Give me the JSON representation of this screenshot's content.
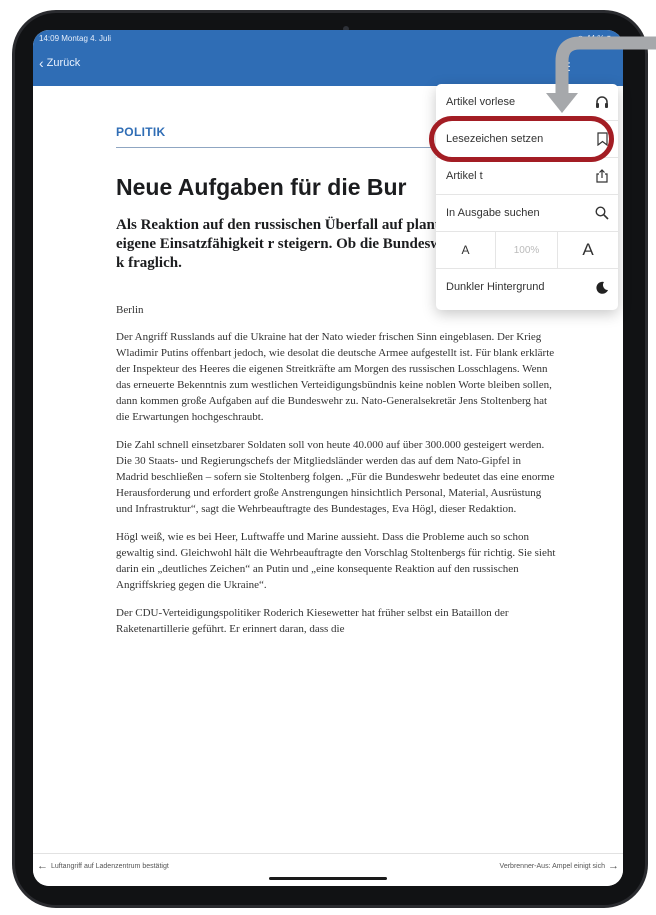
{
  "status": {
    "time_date": "14:09  Montag 4. Juli",
    "right": "◉ 44 % ▮"
  },
  "nav": {
    "back_label": "Zurück"
  },
  "article": {
    "section": "POLITIK",
    "headline": "Neue Aufgaben für die Bur",
    "lead": "Als Reaktion auf den russischen Überfall auf plant die Nato, die eigene Einsatzfähigkeit r steigern. Ob die Bundeswehr das schultern k fraglich.",
    "dateline": "Berlin",
    "paragraphs": [
      "Der Angriff Russlands auf die Ukraine hat der Nato wieder frischen Sinn eingeblasen. Der Krieg Wladimir Putins offenbart jedoch, wie desolat die deutsche Armee aufgestellt ist. Für blank erklärte der Inspekteur des Heeres die eigenen Streitkräfte am Morgen des russischen Losschlagens. Wenn das erneuerte Bekenntnis zum westlichen Verteidigungsbündnis keine noblen Worte bleiben sollen, dann kommen große Aufgaben auf die Bundeswehr zu. Nato-Generalsekretär Jens Stoltenberg hat die Erwartungen hochgeschraubt.",
      "Die Zahl schnell einsetzbarer Soldaten soll von heute 40.000 auf über 300.000 gesteigert werden. Die 30 Staats- und Regierungschefs der Mitgliedsländer werden das auf dem Nato-Gipfel in Madrid beschließen – sofern sie Stoltenberg folgen. „Für die Bundeswehr bedeutet das eine enorme Herausforderung und erfordert große Anstrengungen hinsichtlich Personal, Material, Ausrüstung und Infrastruktur“, sagt die Wehrbeauftragte des Bundestages, Eva Högl, dieser Redaktion.",
      "Högl weiß, wie es bei Heer, Luftwaffe und Marine aussieht. Dass die Probleme auch so schon gewaltig sind. Gleichwohl hält die Wehrbeauftragte den Vorschlag Stoltenbergs für richtig. Sie sieht darin ein „deutliches Zeichen“ an Putin und „eine konsequente Reaktion auf den russischen Angriffskrieg gegen die Ukraine“.",
      "Der CDU-Verteidigungspolitiker Roderich Kiesewetter hat früher selbst ein Bataillon der Raketenartillerie geführt. Er erinnert daran, dass die"
    ]
  },
  "footer": {
    "prev_article": "Luftangriff auf Ladenzentrum bestätigt",
    "next_article": "Verbrenner-Aus: Ampel einigt sich"
  },
  "menu": {
    "read_aloud": "Artikel vorlese",
    "bookmark": "Lesezeichen setzen",
    "share": "Artikel t",
    "search_issue": "In Ausgabe suchen",
    "font_small": "A",
    "font_percent": "100%",
    "font_large": "A",
    "dark_background": "Dunkler Hintergrund"
  },
  "colors": {
    "brand_blue": "#2f6db5",
    "highlight_red": "#a31d24",
    "arrow_grey": "#a6a8ab"
  }
}
